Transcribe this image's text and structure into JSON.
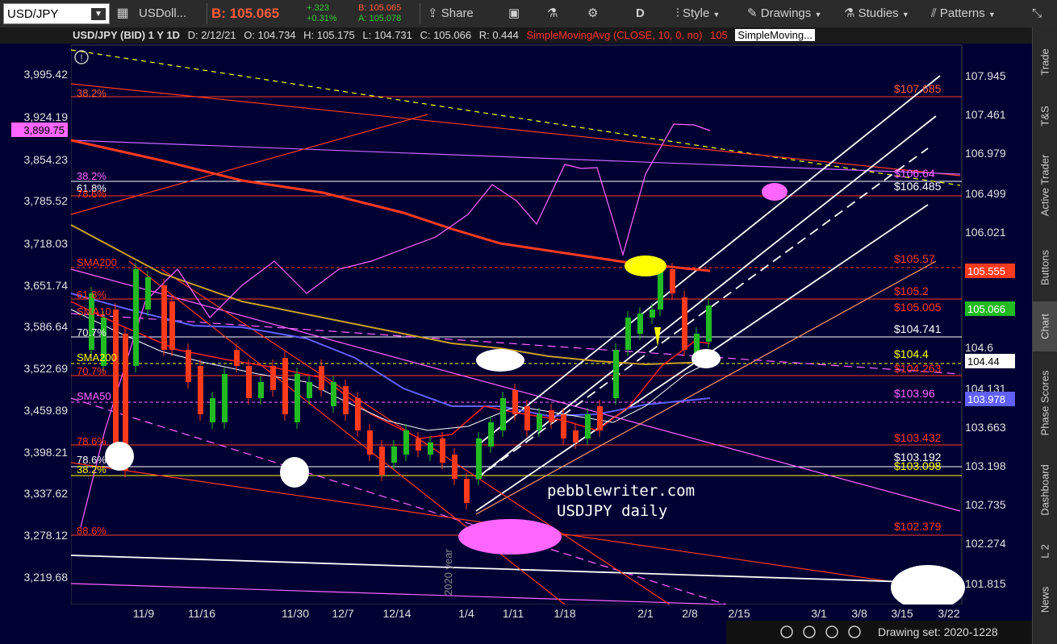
{
  "toolbar": {
    "symbol": "USD/JPY",
    "compare": "USDoll...",
    "bid_label": "B: 105.065",
    "change": "+.323",
    "change_pct": "+0.31%",
    "bid_small": "B: 105.065",
    "ask_small": "A: 105.078",
    "share": "Share",
    "aggregation": "D",
    "style": "Style",
    "drawings": "Drawings",
    "studies": "Studies",
    "patterns": "Patterns"
  },
  "header": {
    "title": "USD/JPY (BID) 1 Y 1D",
    "date": "D: 2/12/21",
    "open": "O: 104.734",
    "high": "H: 105.175",
    "low": "L: 104.731",
    "close": "C: 105.066",
    "range": "R: 0.444",
    "study1": "SimpleMovingAvg (CLOSE, 10, 0, no)",
    "study1_val": "105",
    "study2": "SimpleMoving..."
  },
  "side_tabs": [
    "Trade",
    "T&S",
    "Active Trader",
    "Buttons",
    "Chart",
    "Phase Scores",
    "Dashboard",
    "L 2",
    "News"
  ],
  "left_axis": [
    "3,995.42",
    "3,924.19",
    "3,854.23",
    "3,785.52",
    "3,718.03",
    "3,651.74",
    "3,586.64",
    "3,522.69",
    "3,459.89",
    "3,398.21",
    "3,337.62",
    "3,278.12",
    "3,219.68"
  ],
  "left_marker": "3,899.75",
  "right_axis": [
    "107.945",
    "107.461",
    "106.979",
    "106.499",
    "106.021",
    "104.6",
    "104.131",
    "103.663",
    "103.198",
    "102.735",
    "102.274",
    "101.815"
  ],
  "right_tags": {
    "sma200": "105.555",
    "last": "105.066",
    "white": "104.44",
    "sma50": "103.978"
  },
  "fib_left": [
    "38.2%",
    "38.2%",
    "61.8%",
    "78.6%",
    "SMA200",
    "61.8%",
    "SMA10",
    "70.7%",
    "SMA200",
    "70.7%",
    "SMA50",
    "78.6%",
    "78.6%",
    "38.2%",
    "88.6%"
  ],
  "fib_right": [
    "$107.685",
    "$106.64",
    "$106.485",
    "$105.57",
    "$105.2",
    "$105.005",
    "$104.741",
    "$104.4",
    "$104.263",
    "$103.96",
    "$103.432",
    "$103.192",
    "$103.098",
    "$102.379"
  ],
  "x_labels": [
    "11/9",
    "11/16",
    "11/30",
    "12/7",
    "12/14",
    "1/4",
    "1/11",
    "1/18",
    "2/1",
    "2/8",
    "2/15",
    "3/1",
    "3/8",
    "3/15",
    "3/22"
  ],
  "year_label": "2020 year",
  "watermark1": "pebblewriter.com",
  "watermark2": "USDJPY daily",
  "drawing_set": "Drawing set: 2020-1228",
  "colors": {
    "bg": "#000033",
    "sma200": "#ff3b1f",
    "sma10": "#ff2020",
    "sma50": "#6060ff",
    "magenta": "#ff66ff",
    "yellow": "#ffff00",
    "white": "#ffffff",
    "up": "#22bb22",
    "down": "#ff3a1a"
  },
  "icons": [
    "grid-icon",
    "share-icon",
    "calendar-icon",
    "flask-icon",
    "gear-icon",
    "chart-style-icon",
    "drawing-pen-icon",
    "studies-flask-icon",
    "patterns-icon",
    "collapse-icon",
    "alert-icon",
    "zoom-out-icon",
    "zoom-in-icon",
    "zoom-reset-icon"
  ]
}
